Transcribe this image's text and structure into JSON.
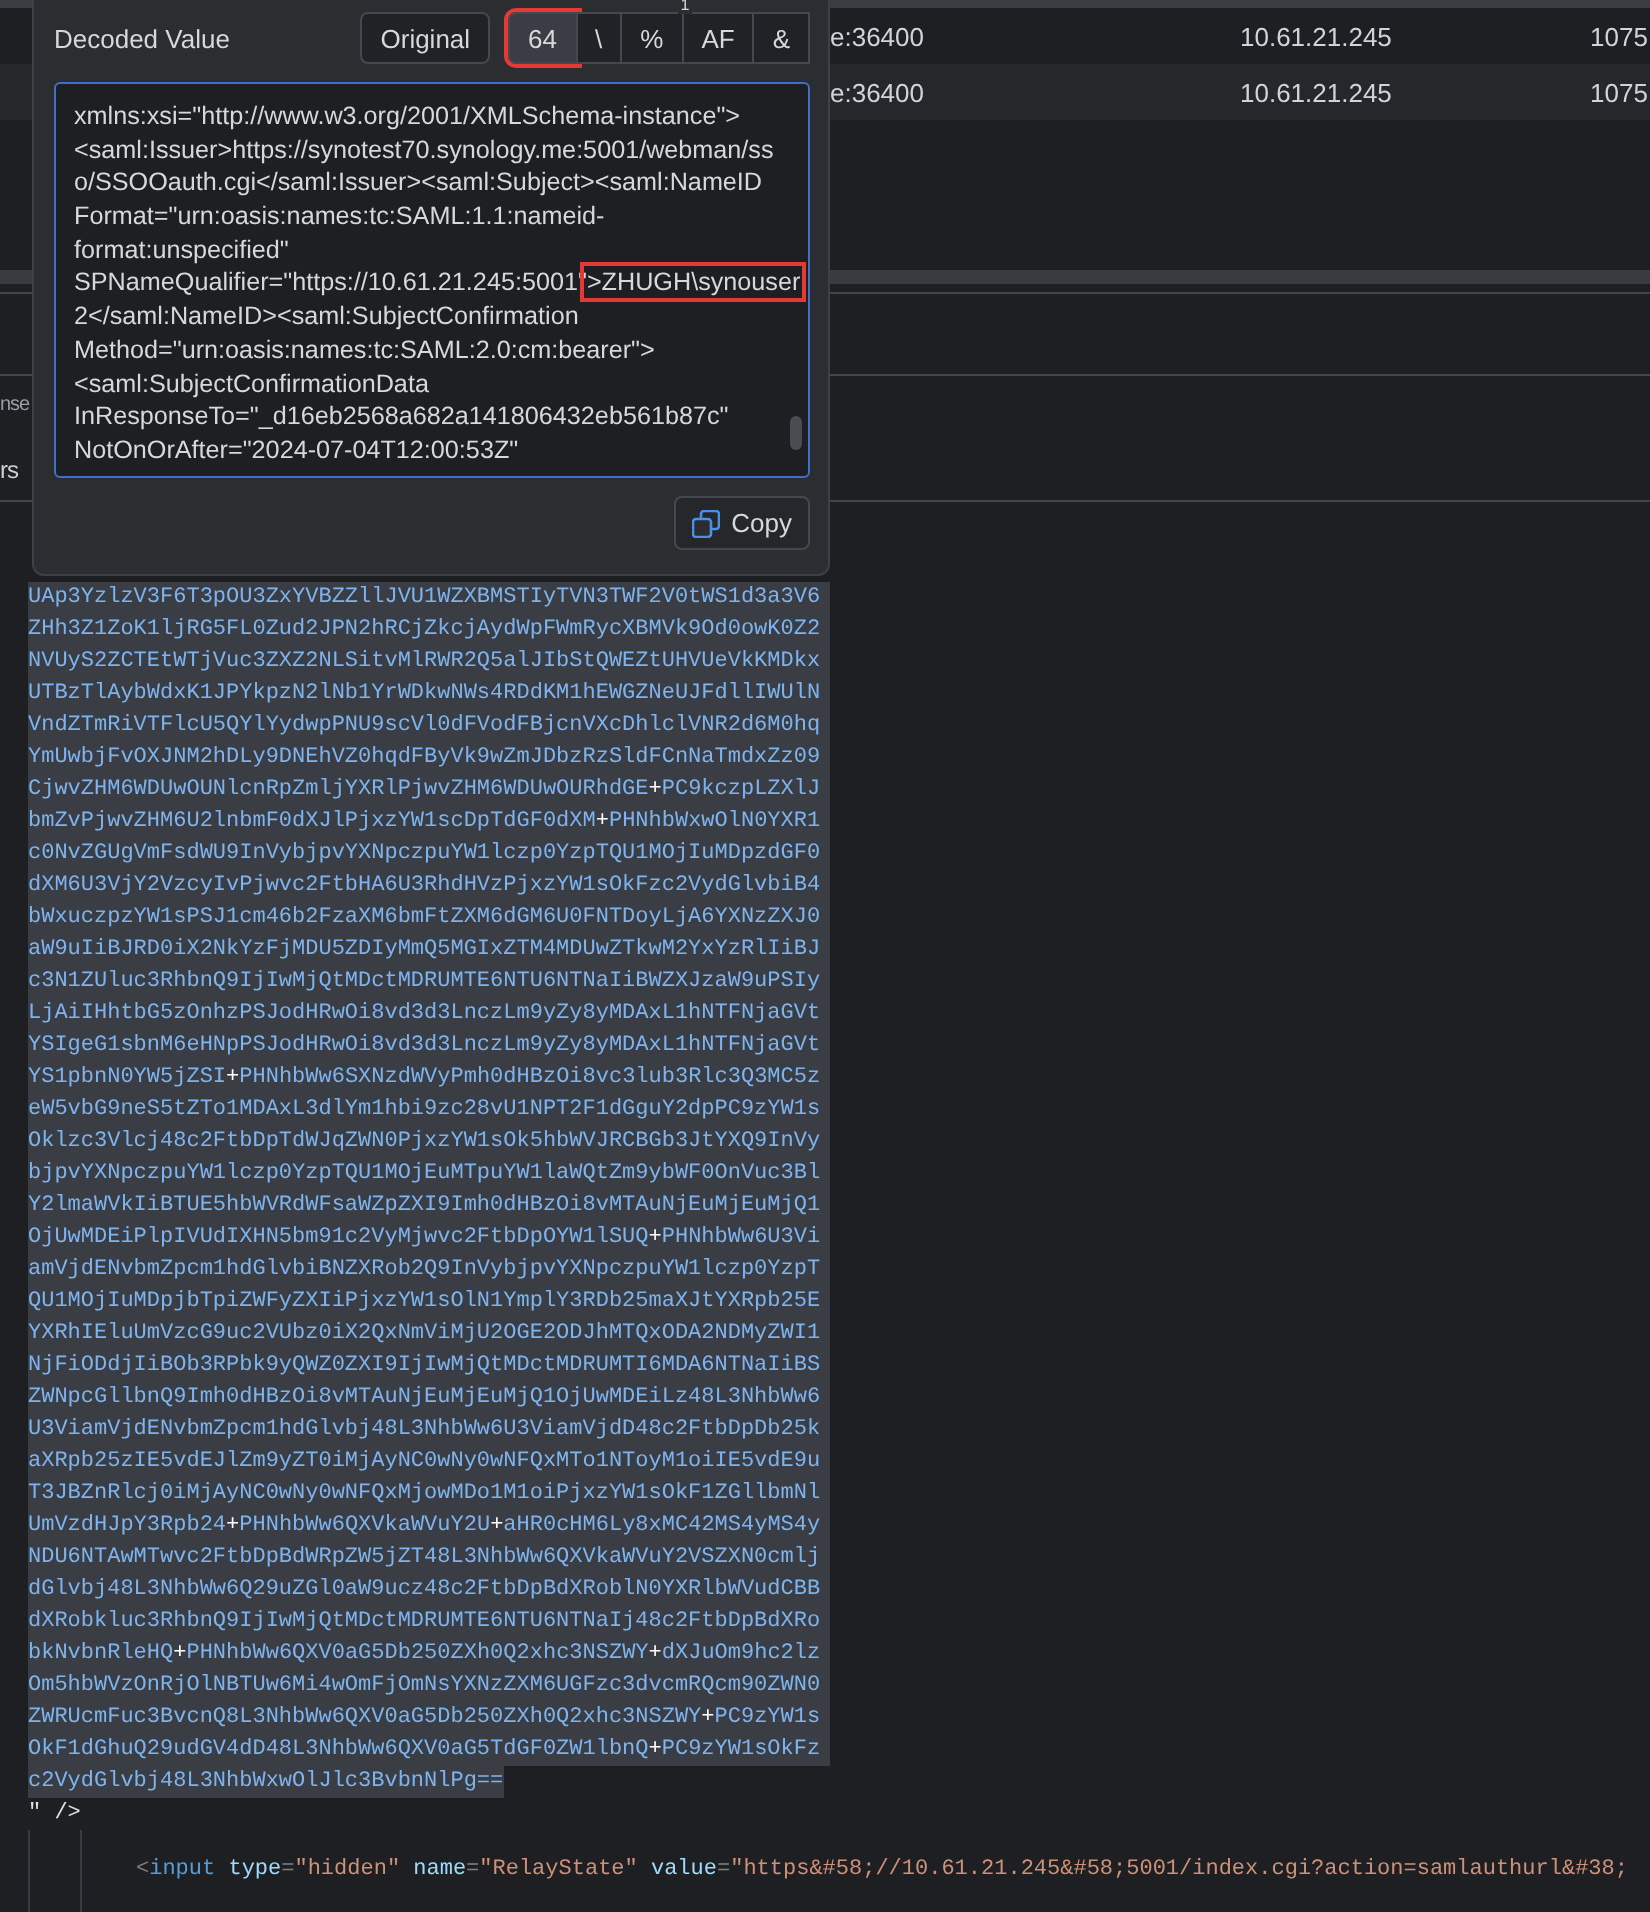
{
  "table": {
    "rows": [
      {
        "cells": [
          "e:36400",
          "10.61.21.245",
          "1075"
        ]
      },
      {
        "cells": [
          "e:36400",
          "10.61.21.245",
          "1075"
        ]
      }
    ]
  },
  "side_fragments": [
    "nse",
    "rs"
  ],
  "popup": {
    "title": "Decoded Value",
    "marker": "1",
    "buttons": [
      {
        "label": "Original",
        "selected": false,
        "annotated": false
      },
      {
        "label": "64",
        "selected": true,
        "annotated": true
      },
      {
        "label": "\\",
        "selected": false,
        "annotated": false
      },
      {
        "label": "%",
        "selected": false,
        "annotated": false
      },
      {
        "label": "AF",
        "selected": false,
        "annotated": false
      },
      {
        "label": "&",
        "selected": false,
        "annotated": false
      }
    ],
    "lines": [
      {
        "text": "xmlns:xsi=\"http://www.w3.org/2001/XMLSchema-instance\">"
      },
      {
        "text": "<saml:Issuer>https://synotest70.synology.me:5001/webman/ss"
      },
      {
        "text": "o/SSOOauth.cgi</saml:Issuer><saml:Subject><saml:NameID"
      },
      {
        "text": "Format=\"urn:oasis:names:tc:SAML:1.1:nameid-"
      },
      {
        "text": "format:unspecified\""
      },
      {
        "text": "SPNameQualifier=\"https://10.61.21.245:5001\"",
        "highlight": ">ZHUGH\\synouser"
      },
      {
        "text": "2</saml:NameID><saml:SubjectConfirmation"
      },
      {
        "text": "Method=\"urn:oasis:names:tc:SAML:2.0:cm:bearer\">"
      },
      {
        "text": "<saml:SubjectConfirmationData"
      },
      {
        "text": "InResponseTo=\"_d16eb2568a682a141806432eb561b87c\""
      },
      {
        "text": "NotOnOrAfter=\"2024-07-04T12:00:53Z\""
      }
    ],
    "copy_button": "Copy"
  },
  "code": {
    "base64_lines": [
      "UAp3YzlzV3F6T3pOU3ZxYVBZZllJVU1WZXBMSTIyTVN3TWF2V0tWS1d3a3V6",
      "ZHh3Z1ZoK1ljRG5FL0Zud2JPN2hRCjZkcjAydWpFWmRycXBMVk9Od0owK0Z2",
      "NVUyS2ZCTEtWTjVuc3ZXZ2NLSitvMlRWR2Q5alJIbStQWEZtUHVUeVkKMDkx",
      "UTBzTlAybWdxK1JPYkpzN2lNb1YrWDkwNWs4RDdKM1hEWGZNeUJFdllIWUlN",
      "VndZTmRiVTFlcU5QYlYydwpPNU9scVl0dFVodFBjcnVXcDhlclVNR2d6M0hq",
      "YmUwbjFvOXJNM2hDLy9DNEhVZ0hqdFByVk9wZmJDbzRzSldFCnNaTmdxZz09",
      "CjwvZHM6WDUwOUNlcnRpZmljYXRlPjwvZHM6WDUwOURhdGE+PC9kczpLZXlJ",
      "bmZvPjwvZHM6U2lnbmF0dXJlPjxzYW1scDpTdGF0dXM+PHNhbWxwOlN0YXR1",
      "c0NvZGUgVmFsdWU9InVybjpvYXNpczpuYW1lczp0YzpTQU1MOjIuMDpzdGF0",
      "dXM6U3VjY2VzcyIvPjwvc2FtbHA6U3RhdHVzPjxzYW1sOkFzc2VydGlvbiB4",
      "bWxuczpzYW1sPSJ1cm46b2FzaXM6bmFtZXM6dGM6U0FNTDoyLjA6YXNzZXJ0",
      "aW9uIiBJRD0iX2NkYzFjMDU5ZDIyMmQ5MGIxZTM4MDUwZTkwM2YxYzRlIiBJ",
      "c3N1ZUluc3RhbnQ9IjIwMjQtMDctMDRUMTE6NTU6NTNaIiBWZXJzaW9uPSIy",
      "LjAiIHhtbG5zOnhzPSJodHRwOi8vd3d3LnczLm9yZy8yMDAxL1hNTFNjaGVt",
      "YSIgeG1sbnM6eHNpPSJodHRwOi8vd3d3LnczLm9yZy8yMDAxL1hNTFNjaGVt",
      "YS1pbnN0YW5jZSI+PHNhbWw6SXNzdWVyPmh0dHBzOi8vc3lub3Rlc3Q3MC5z",
      "eW5vbG9neS5tZTo1MDAxL3dlYm1hbi9zc28vU1NPT2F1dGguY2dpPC9zYW1s",
      "Oklzc3Vlcj48c2FtbDpTdWJqZWN0PjxzYW1sOk5hbWVJRCBGb3JtYXQ9InVy",
      "bjpvYXNpczpuYW1lczp0YzpTQU1MOjEuMTpuYW1laWQtZm9ybWF0OnVuc3Bl",
      "Y2lmaWVkIiBTUE5hbWVRdWFsaWZpZXI9Imh0dHBzOi8vMTAuNjEuMjEuMjQ1",
      "OjUwMDEiPlpIVUdIXHN5bm91c2VyMjwvc2FtbDpOYW1lSUQ+PHNhbWw6U3Vi",
      "amVjdENvbmZpcm1hdGlvbiBNZXRob2Q9InVybjpvYXNpczpuYW1lczp0YzpT",
      "QU1MOjIuMDpjbTpiZWFyZXIiPjxzYW1sOlN1YmplY3RDb25maXJtYXRpb25E",
      "YXRhIEluUmVzcG9uc2VUbz0iX2QxNmViMjU2OGE2ODJhMTQxODA2NDMyZWI1",
      "NjFiODdjIiBOb3RPbk9yQWZ0ZXI9IjIwMjQtMDctMDRUMTI6MDA6NTNaIiBS",
      "ZWNpcGllbnQ9Imh0dHBzOi8vMTAuNjEuMjEuMjQ1OjUwMDEiLz48L3NhbWw6",
      "U3ViamVjdENvbmZpcm1hdGlvbj48L3NhbWw6U3ViamVjdD48c2FtbDpDb25k",
      "aXRpb25zIE5vdEJlZm9yZT0iMjAyNC0wNy0wNFQxMTo1NToyM1oiIE5vdE9u",
      "T3JBZnRlcj0iMjAyNC0wNy0wNFQxMjowMDo1M1oiPjxzYW1sOkF1ZGllbmNl",
      "UmVzdHJpY3Rpb24+PHNhbWw6QXVkaWVuY2U+aHR0cHM6Ly8xMC42MS4yMS4y",
      "NDU6NTAwMTwvc2FtbDpBdWRpZW5jZT48L3NhbWw6QXVkaWVuY2VSZXN0cmlj",
      "dGlvbj48L3NhbWw6Q29uZGl0aW9ucz48c2FtbDpBdXRoblN0YXRlbWVudCBB",
      "dXRobkluc3RhbnQ9IjIwMjQtMDctMDRUMTE6NTU6NTNaIj48c2FtbDpBdXRo",
      "bkNvbnRleHQ+PHNhbWw6QXV0aG5Db250ZXh0Q2xhc3NSZWY+dXJuOm9hc2lz",
      "Om5hbWVzOnRjOlNBTUw6Mi4wOmFjOmNsYXNzZXM6UGFzc3dvcmRQcm90ZWN0",
      "ZWRUcmFuc3BvcnQ8L3NhbWw6QXV0aG5Db250ZXh0Q2xhc3NSZWY+PC9zYW1s",
      "OkF1dGhuQ29udGV4dD48L3NhbWw6QXV0aG5TdGF0ZW1lbnQ+PC9zYW1sOkFz",
      "c2VydGlvbj48L3NhbWxwOlJlc3BvbnNlPg=="
    ],
    "closing": "\" />",
    "input_line": [
      {
        "kind": "punct",
        "text": "<"
      },
      {
        "kind": "tag",
        "text": "input"
      },
      {
        "kind": "attr",
        "text": "type"
      },
      {
        "kind": "punct",
        "text": "="
      },
      {
        "kind": "string",
        "text": "\"hidden\""
      },
      {
        "kind": "attr",
        "text": "name"
      },
      {
        "kind": "punct",
        "text": "="
      },
      {
        "kind": "string",
        "text": "\"RelayState\""
      },
      {
        "kind": "attr",
        "text": "value"
      },
      {
        "kind": "punct",
        "text": "="
      },
      {
        "kind": "string",
        "text": "\"https&#58;//10.61.21.245&#58;5001/index.cgi?action=samlauthurl&#38;"
      }
    ]
  }
}
